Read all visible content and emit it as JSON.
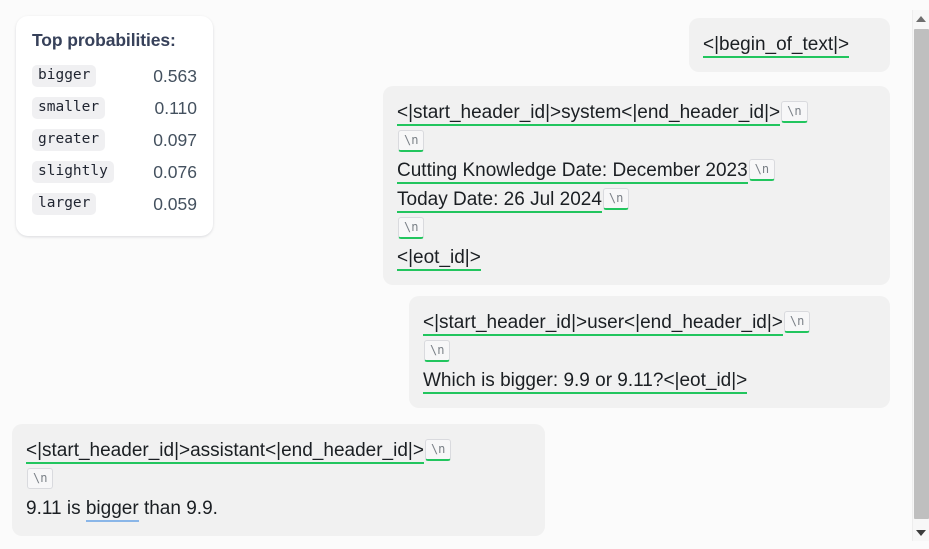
{
  "probabilities_panel": {
    "title": "Top probabilities:",
    "rows": [
      {
        "token": "bigger",
        "value": "0.563"
      },
      {
        "token": "smaller",
        "value": "0.110"
      },
      {
        "token": "greater",
        "value": "0.097"
      },
      {
        "token": "slightly",
        "value": "0.076"
      },
      {
        "token": "larger",
        "value": "0.059"
      }
    ]
  },
  "colors": {
    "page_background": "#fbfbfb",
    "card_background": "#ffffff",
    "bubble_background": "#f1f1f1",
    "token_underline_green": "#22c55e",
    "token_underline_blue": "#8ab6e8",
    "title_text": "#37415a",
    "value_text": "#44515f",
    "newline_chip_text": "#7a8087",
    "scrollbar_thumb": "#bfbfbf"
  },
  "conversation": {
    "bos": {
      "line": "<|begin_of_text|>"
    },
    "system": {
      "header": "<|start_header_id|>system<|end_header_id|>",
      "newline_1": "\\n",
      "newline_2": "\\n",
      "body_line_1": "Cutting Knowledge Date: December 2023",
      "body_line_1_newline": "\\n",
      "body_line_2": "Today Date: 26 Jul 2024",
      "body_line_2_newline": "\\n",
      "newline_3": "\\n",
      "eot": "<|eot_id|>"
    },
    "user": {
      "header": "<|start_header_id|>user<|end_header_id|>",
      "newline_1": "\\n",
      "newline_2": "\\n",
      "body": "Which is bigger: 9.9 or 9.11?<|eot_id|>"
    },
    "assistant": {
      "header": "<|start_header_id|>assistant<|end_header_id|>",
      "newline_1": "\\n",
      "newline_2": "\\n",
      "body_prefix": "9.11 is ",
      "body_selected_token": "bigger",
      "body_suffix": " than 9.9."
    }
  },
  "scrollbar": {
    "up_arrow": "scroll-up",
    "down_arrow": "scroll-down"
  }
}
